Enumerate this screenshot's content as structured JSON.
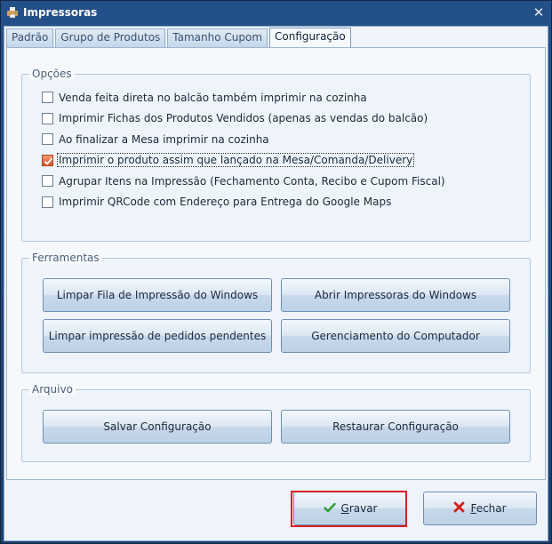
{
  "window": {
    "title": "Impressoras"
  },
  "tabs": [
    {
      "label": "Padrão",
      "active": false
    },
    {
      "label": "Grupo de Produtos",
      "active": false
    },
    {
      "label": "Tamanho Cupom",
      "active": false
    },
    {
      "label": "Configuração",
      "active": true
    }
  ],
  "opcoes": {
    "legend": "Opções",
    "items": [
      {
        "label": "Venda feita direta no balcão também imprimir na cozinha",
        "checked": false
      },
      {
        "label": "Imprimir Fichas dos Produtos Vendidos (apenas as vendas do balcão)",
        "checked": false
      },
      {
        "label": "Ao finalizar a Mesa imprimir na cozinha",
        "checked": false
      },
      {
        "label": "Imprimir o produto assim que lançado na Mesa/Comanda/Delivery",
        "checked": true
      },
      {
        "label": "Agrupar Itens na Impressão (Fechamento Conta, Recibo e Cupom Fiscal)",
        "checked": false
      },
      {
        "label": "Imprimir QRCode com Endereço para Entrega do Google Maps",
        "checked": false
      }
    ]
  },
  "ferramentas": {
    "legend": "Ferramentas",
    "buttons": [
      "Limpar Fila de Impressão do Windows",
      "Abrir Impressoras do Windows",
      "Limpar impressão de pedidos pendentes",
      "Gerenciamento do Computador"
    ]
  },
  "arquivo": {
    "legend": "Arquivo",
    "buttons": [
      "Salvar Configuração",
      "Restaurar Configuração"
    ]
  },
  "footer": {
    "gravar_mnemonic": "G",
    "gravar_rest": "ravar",
    "fechar_mnemonic": "F",
    "fechar_rest": "echar"
  },
  "colors": {
    "titlebar": "#24508a",
    "accent_check": "#d8542c",
    "highlight": "#d8202a",
    "gravar_icon": "#2f9a2f",
    "fechar_icon": "#d21f1f"
  },
  "icons": {
    "app": "printer-icon",
    "close": "close-icon",
    "gravar": "check-icon",
    "fechar": "x-icon"
  }
}
